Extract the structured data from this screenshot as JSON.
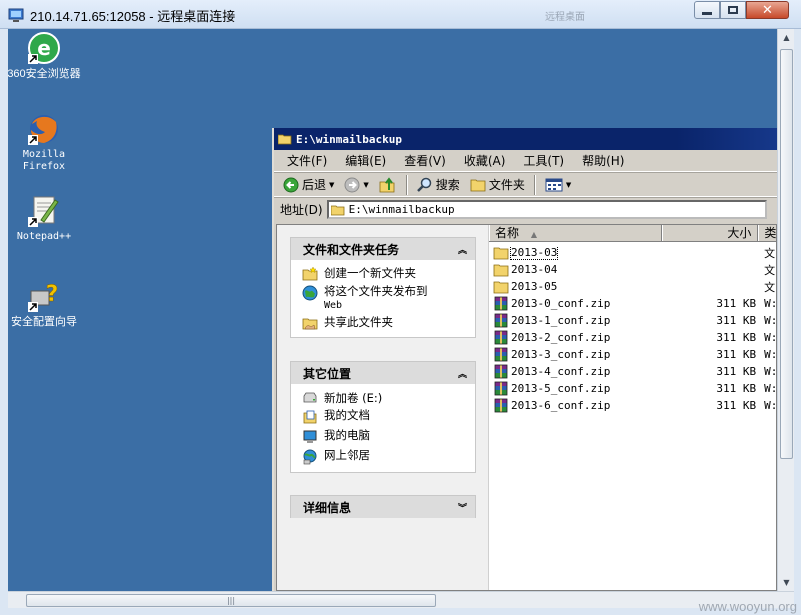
{
  "rdp": {
    "title": "210.14.71.65:12058 - 远程桌面连接",
    "ghost_text": "远程桌面"
  },
  "desktop": {
    "icons": [
      {
        "label": "360安全浏览器",
        "icon": "browser-360-icon"
      },
      {
        "label": "Mozilla Firefox",
        "icon": "firefox-icon"
      },
      {
        "label": "Notepad++",
        "icon": "notepad-plus-icon"
      },
      {
        "label": "安全配置向导",
        "icon": "security-wizard-icon"
      }
    ]
  },
  "explorer": {
    "title": "E:\\winmailbackup",
    "menu": [
      "文件(F)",
      "编辑(E)",
      "查看(V)",
      "收藏(A)",
      "工具(T)",
      "帮助(H)"
    ],
    "toolbar": {
      "back": "后退",
      "search": "搜索",
      "folders": "文件夹"
    },
    "address": {
      "label": "地址(D)",
      "value": "E:\\winmailbackup"
    },
    "taskpane": {
      "tasks": {
        "title": "文件和文件夹任务",
        "items": [
          "创建一个新文件夹",
          "将这个文件夹发布到",
          "Web",
          "共享此文件夹"
        ]
      },
      "places": {
        "title": "其它位置",
        "items": [
          "新加卷 (E:)",
          "我的文档",
          "我的电脑",
          "网上邻居"
        ]
      },
      "details": {
        "title": "详细信息"
      }
    },
    "columns": {
      "name": "名称",
      "size": "大小",
      "type": "类"
    },
    "files": [
      {
        "name": "2013-03",
        "size": "",
        "type": "文",
        "kind": "folder"
      },
      {
        "name": "2013-04",
        "size": "",
        "type": "文",
        "kind": "folder"
      },
      {
        "name": "2013-05",
        "size": "",
        "type": "文",
        "kind": "folder"
      },
      {
        "name": "2013-0_conf.zip",
        "size": "311 KB",
        "type": "W:",
        "kind": "zip"
      },
      {
        "name": "2013-1_conf.zip",
        "size": "311 KB",
        "type": "W:",
        "kind": "zip"
      },
      {
        "name": "2013-2_conf.zip",
        "size": "311 KB",
        "type": "W:",
        "kind": "zip"
      },
      {
        "name": "2013-3_conf.zip",
        "size": "311 KB",
        "type": "W:",
        "kind": "zip"
      },
      {
        "name": "2013-4_conf.zip",
        "size": "311 KB",
        "type": "W:",
        "kind": "zip"
      },
      {
        "name": "2013-5_conf.zip",
        "size": "311 KB",
        "type": "W:",
        "kind": "zip"
      },
      {
        "name": "2013-6_conf.zip",
        "size": "311 KB",
        "type": "W:",
        "kind": "zip"
      }
    ]
  },
  "watermark": "www.wooyun.org",
  "colors": {
    "desktop": "#3b6ea5",
    "title_active": "#0a246a",
    "chrome": "#d4d0c8"
  }
}
